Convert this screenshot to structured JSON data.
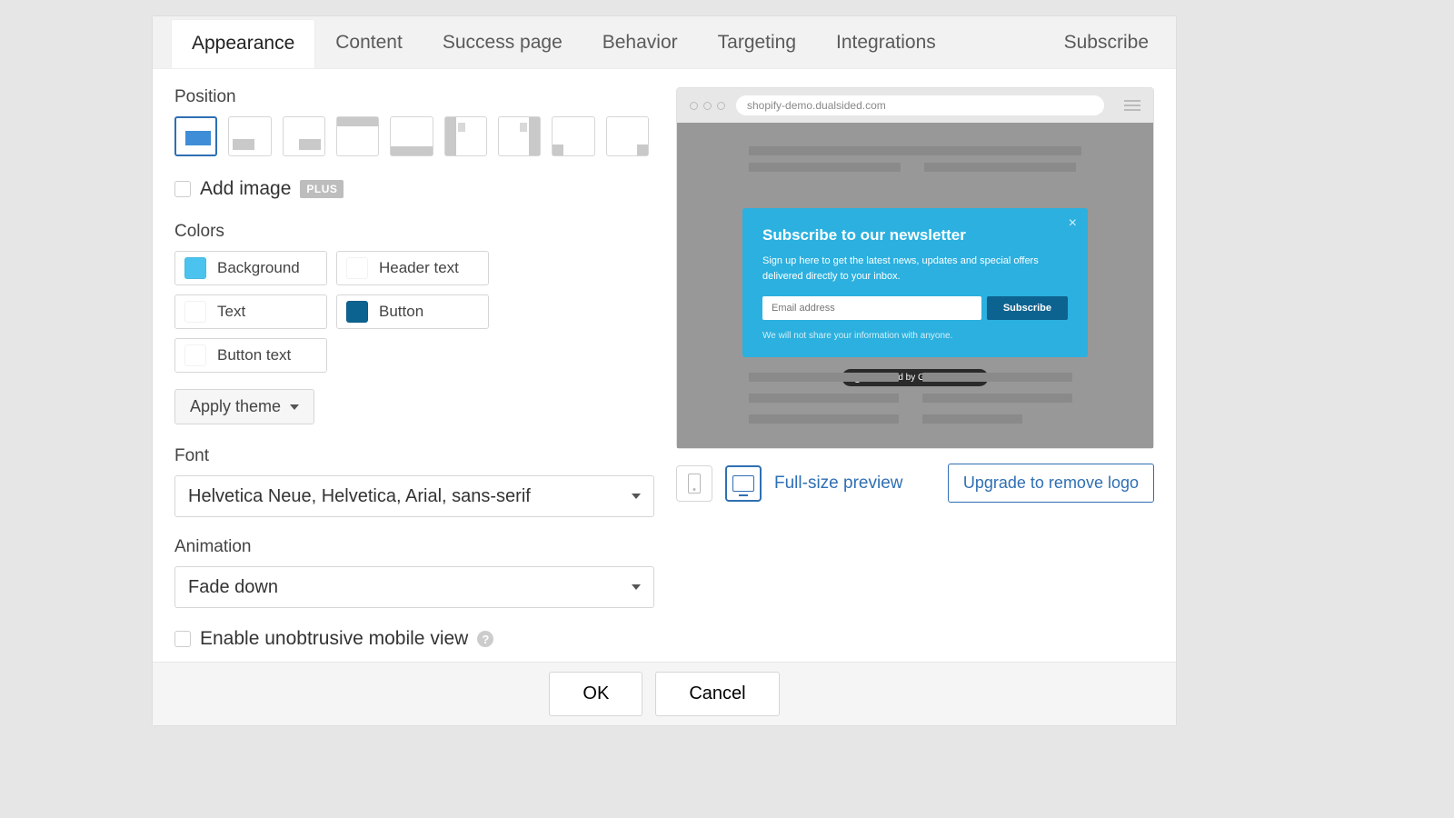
{
  "tabs": [
    "Appearance",
    "Content",
    "Success page",
    "Behavior",
    "Targeting",
    "Integrations"
  ],
  "active_tab": 0,
  "header_right": "Subscribe",
  "position": {
    "label": "Position",
    "selected": 0,
    "count": 9
  },
  "add_image": {
    "label": "Add image",
    "badge": "PLUS",
    "checked": false
  },
  "colors": {
    "label": "Colors",
    "items": [
      {
        "label": "Background",
        "hex": "#4bc3ef"
      },
      {
        "label": "Header text",
        "hex": "#ffffff"
      },
      {
        "label": "Text",
        "hex": "#ffffff"
      },
      {
        "label": "Button",
        "hex": "#0d6390"
      },
      {
        "label": "Button text",
        "hex": "#ffffff"
      }
    ]
  },
  "apply_theme": {
    "label": "Apply theme"
  },
  "font": {
    "label": "Font",
    "value": "Helvetica Neue, Helvetica, Arial, sans-serif"
  },
  "animation": {
    "label": "Animation",
    "value": "Fade down"
  },
  "mobile_view": {
    "label": "Enable unobtrusive mobile view",
    "checked": false
  },
  "preview": {
    "url": "shopify-demo.dualsided.com",
    "popup": {
      "title": "Subscribe to our newsletter",
      "description": "Sign up here to get the latest news, updates and special offers delivered directly to your inbox.",
      "placeholder": "Email address",
      "button": "Subscribe",
      "footnote": "We will not share your information with anyone."
    },
    "powered": "Powered by GetSiteControl",
    "fullsize_link": "Full-size preview",
    "upgrade": "Upgrade to remove logo"
  },
  "footer": {
    "ok": "OK",
    "cancel": "Cancel"
  }
}
